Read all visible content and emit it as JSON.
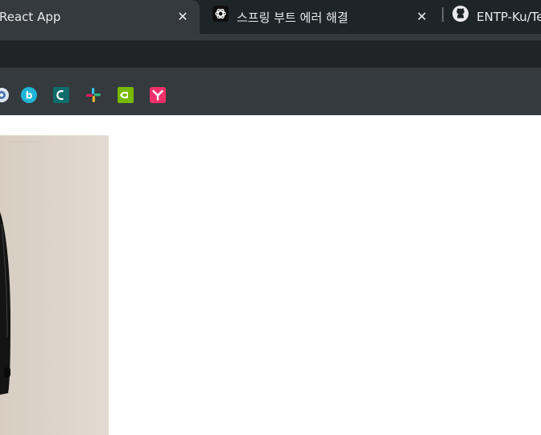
{
  "tabs": [
    {
      "title": "React App",
      "active": true,
      "close_label": "✕"
    },
    {
      "title": "스프링 부트 에러 해결",
      "active": false,
      "close_label": "✕",
      "favicon": "chatgpt-icon"
    },
    {
      "title": "ENTP-Ku/Te",
      "active": false,
      "favicon": "github-icon"
    }
  ],
  "bookmarks": [
    {
      "icon": "bookmark-partial-icon"
    },
    {
      "icon": "bookmark-b-circle-icon",
      "color": "#1fb4d6"
    },
    {
      "icon": "bookmark-teal-c-icon",
      "color": "#0e6d6a"
    },
    {
      "icon": "slack-icon"
    },
    {
      "icon": "nvidia-icon",
      "color": "#76b900"
    },
    {
      "icon": "bookmark-pink-y-icon",
      "color": "#f0306b"
    }
  ],
  "colors": {
    "tab_strip": "#1e2529",
    "active_tab": "#343a3e",
    "toolbar": "#343a3e",
    "page": "#ffffff"
  }
}
